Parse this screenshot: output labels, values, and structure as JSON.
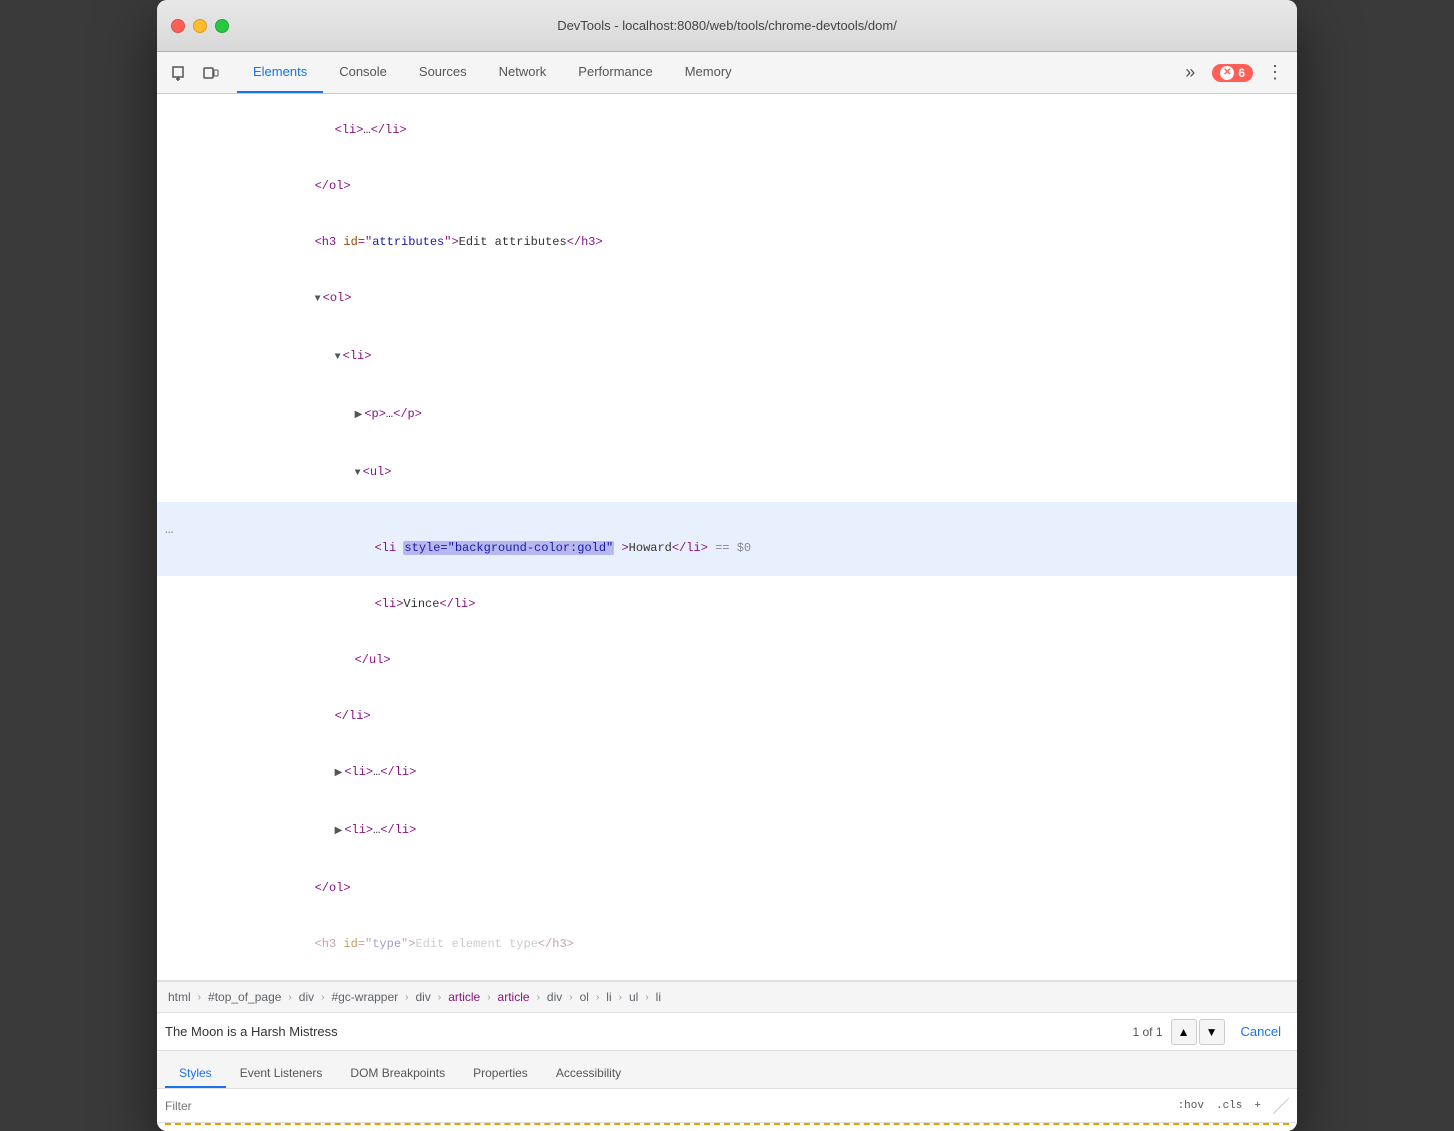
{
  "window": {
    "title": "DevTools - localhost:8080/web/tools/chrome-devtools/dom/"
  },
  "toolbar": {
    "tabs": [
      {
        "label": "Elements",
        "active": true
      },
      {
        "label": "Console",
        "active": false
      },
      {
        "label": "Sources",
        "active": false
      },
      {
        "label": "Network",
        "active": false
      },
      {
        "label": "Performance",
        "active": false
      },
      {
        "label": "Memory",
        "active": false
      }
    ],
    "more_label": "»",
    "error_count": "6"
  },
  "dom": {
    "lines": [
      {
        "indent": 4,
        "content": "<li>…</li>",
        "type": "collapsed-li"
      },
      {
        "indent": 3,
        "content": "</ol>",
        "type": "close"
      },
      {
        "indent": 3,
        "content": "<h3 id=\"attributes\">Edit attributes</h3>",
        "type": "h3"
      },
      {
        "indent": 3,
        "content": "▼<ol>",
        "type": "open"
      },
      {
        "indent": 4,
        "content": "▼<li>",
        "type": "open"
      },
      {
        "indent": 5,
        "content": "▶<p>…</p>",
        "type": "collapsed"
      },
      {
        "indent": 5,
        "content": "▼<ul>",
        "type": "open"
      },
      {
        "indent": 6,
        "content": "<li style=\"background-color:gold\">Howard</li> == $0",
        "type": "selected"
      },
      {
        "indent": 6,
        "content": "<li>Vince</li>",
        "type": "normal"
      },
      {
        "indent": 5,
        "content": "</ul>",
        "type": "close"
      },
      {
        "indent": 4,
        "content": "</li>",
        "type": "close"
      },
      {
        "indent": 4,
        "content": "▶<li>…</li>",
        "type": "collapsed"
      },
      {
        "indent": 4,
        "content": "▶<li>…</li>",
        "type": "collapsed"
      },
      {
        "indent": 3,
        "content": "</ol>",
        "type": "close"
      },
      {
        "indent": 3,
        "content": "<h3 id=\"type\">Edit element type</h3>",
        "type": "partial"
      }
    ]
  },
  "breadcrumb": {
    "items": [
      {
        "label": "html",
        "purple": false
      },
      {
        "label": "#top_of_page",
        "purple": false
      },
      {
        "label": "div",
        "purple": false
      },
      {
        "label": "#gc-wrapper",
        "purple": false
      },
      {
        "label": "div",
        "purple": false
      },
      {
        "label": "article",
        "purple": true
      },
      {
        "label": "article",
        "purple": true
      },
      {
        "label": "div",
        "purple": false
      },
      {
        "label": "ol",
        "purple": false
      },
      {
        "label": "li",
        "purple": false
      },
      {
        "label": "ul",
        "purple": false
      },
      {
        "label": "li",
        "purple": false
      }
    ]
  },
  "search": {
    "value": "The Moon is a Harsh Mistress",
    "count": "1 of 1",
    "cancel_label": "Cancel"
  },
  "bottom_tabs": [
    {
      "label": "Styles",
      "active": true
    },
    {
      "label": "Event Listeners",
      "active": false
    },
    {
      "label": "DOM Breakpoints",
      "active": false
    },
    {
      "label": "Properties",
      "active": false
    },
    {
      "label": "Accessibility",
      "active": false
    }
  ],
  "filter": {
    "placeholder": "Filter",
    "hov_label": ":hov",
    "cls_label": ".cls",
    "plus_label": "+"
  }
}
